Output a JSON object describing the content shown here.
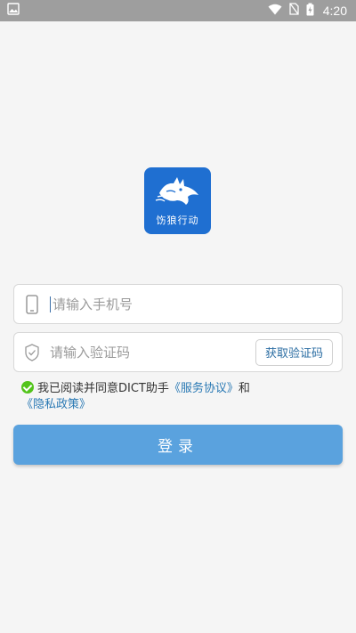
{
  "status_bar": {
    "time": "4:20",
    "icons": [
      "image-icon",
      "wifi-icon",
      "no-sim-icon",
      "battery-charging-icon"
    ]
  },
  "app": {
    "logo_text": "饬狼行动"
  },
  "phone_field": {
    "placeholder": "请输入手机号",
    "value": ""
  },
  "code_field": {
    "placeholder": "请输入验证码",
    "value": "",
    "get_code_label": "获取验证码"
  },
  "agreement": {
    "checked": true,
    "prefix": "我已阅读并同意DICT助手",
    "service_link": "《服务协议》",
    "conjunction": "和",
    "privacy_link": "《隐私政策》"
  },
  "login": {
    "label": "登录"
  },
  "colors": {
    "accent": "#5aa2de",
    "brand": "#1f6fd1",
    "link": "#2a79b4",
    "check": "#52c41a"
  }
}
